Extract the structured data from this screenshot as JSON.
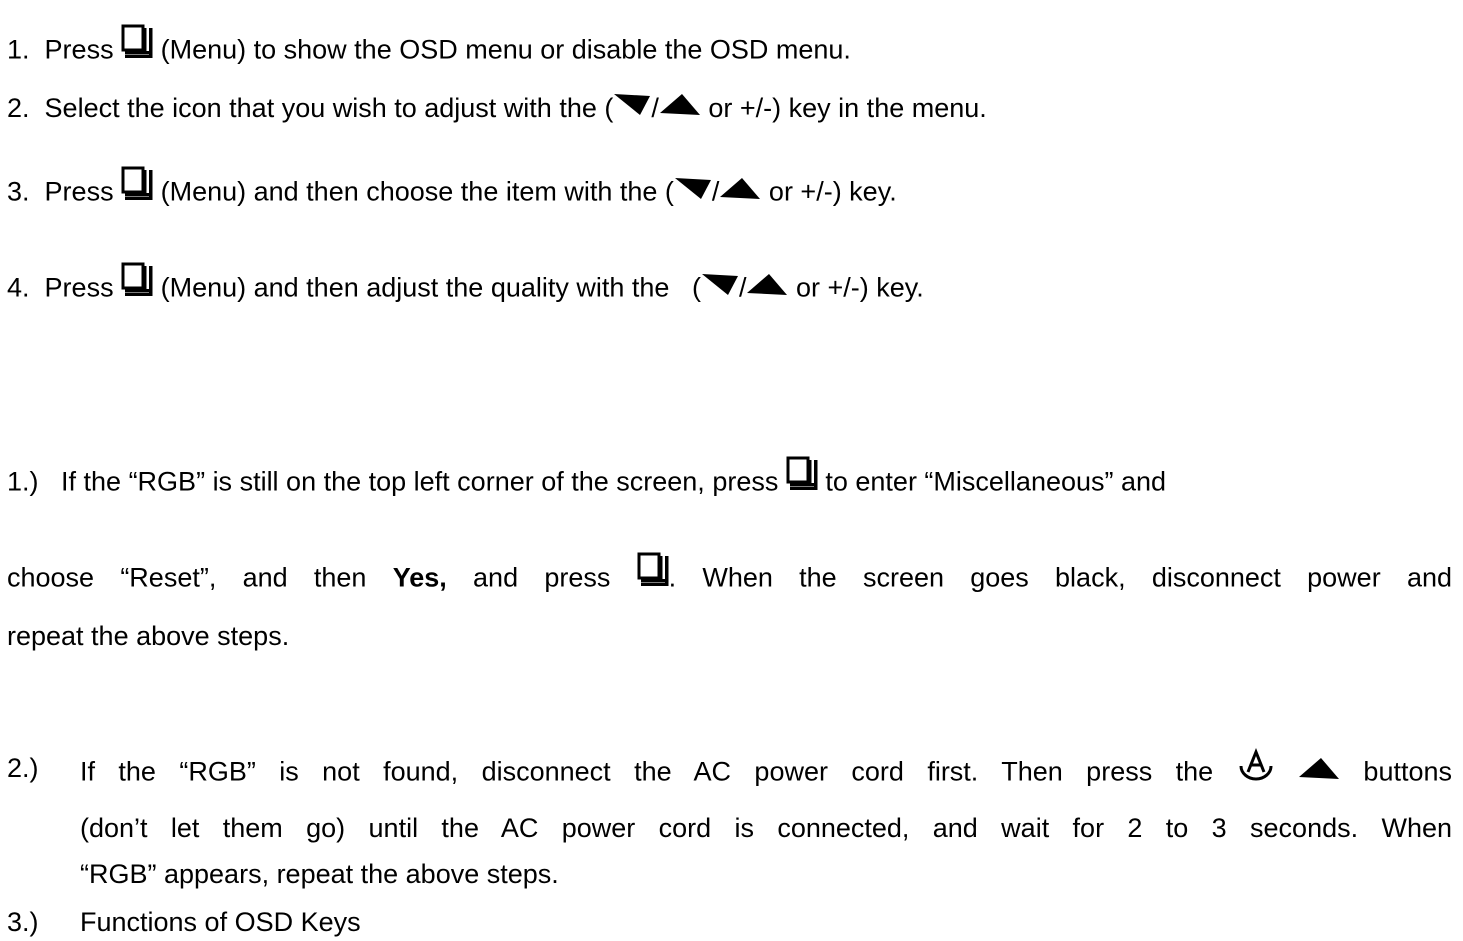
{
  "steps": [
    {
      "num": "1.",
      "press": "Press",
      "rest": "(Menu) to show the OSD menu or disable the OSD menu."
    },
    {
      "num": "2.",
      "pre": "Select the icon that you wish to adjust with the (",
      "post": "or +/-) key in the menu."
    },
    {
      "num": "3.",
      "press": "Press",
      "mid": "(Menu) and then choose the item with the (",
      "post": "or +/-) key."
    },
    {
      "num": "4.",
      "press": "Press",
      "mid": "(Menu) and then adjust the quality with the",
      "mid2": "(",
      "post": "or +/-) key."
    }
  ],
  "notes": {
    "n1": {
      "num": "1.)",
      "a": "If the “RGB” is still on the top left corner of the screen, press",
      "b": "to enter “Miscellaneous” and",
      "c": "choose “Reset”, and then",
      "yes": "Yes,",
      "d": "and press",
      "e": ". When the screen goes black, disconnect power and",
      "f": "repeat the above steps."
    },
    "n2": {
      "num": "2.)",
      "a": "If the “RGB” is not found, disconnect the AC power cord first. Then press the",
      "b": "buttons",
      "c": "(don’t let them go) until the AC power cord is connected, and wait for 2 to 3 seconds. When",
      "d": "“RGB” appears, repeat the above steps."
    },
    "n3": {
      "num": "3.)",
      "a": "Functions of OSD Keys"
    }
  },
  "icons": {
    "menu": "menu-icon",
    "down": "down-arrow-icon",
    "up": "up-arrow-icon",
    "auto": "auto-adjust-icon"
  }
}
